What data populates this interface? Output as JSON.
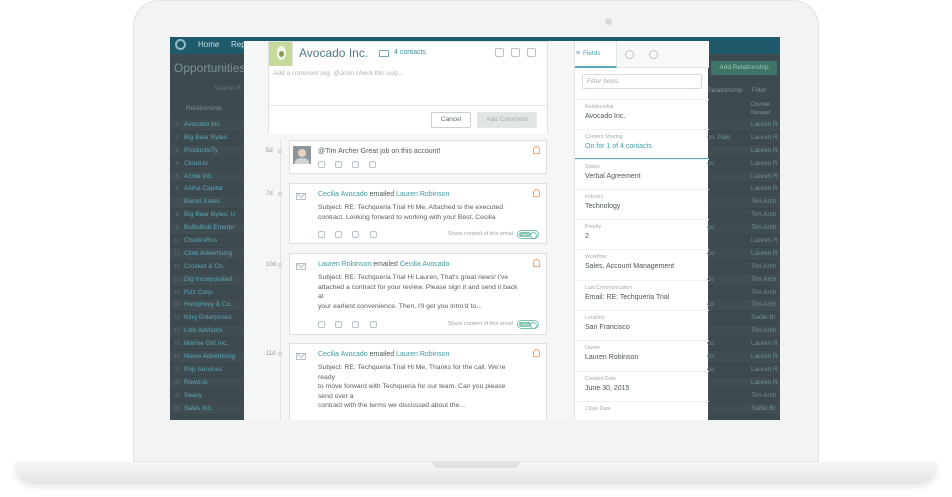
{
  "background_app": {
    "nav": [
      "Home",
      "Rep"
    ],
    "page_title": "Opportunities",
    "search_placeholder": "Search R",
    "add_button": "Add Relationship",
    "filter_label": "Filter",
    "relationship_header": "Relationship",
    "relationship_header_right": "Relationship",
    "owner_header": "Owner",
    "owner_sub": "Manager",
    "rows": [
      {
        "num": "1",
        "name": "Avocado Inc.",
        "mid": "",
        "owner": "Lauren R"
      },
      {
        "num": "2",
        "name": "Big Bear Bytes",
        "mid": "co, Palo",
        "owner": "Lauren R"
      },
      {
        "num": "3",
        "name": "ProductivTy",
        "mid": "",
        "owner": "Lauren R"
      },
      {
        "num": "4",
        "name": "Cloud.io",
        "mid": "co",
        "owner": "Lauren R"
      },
      {
        "num": "5",
        "name": "Acme Inc.",
        "mid": "",
        "owner": "Lauren R"
      },
      {
        "num": "6",
        "name": "Aloha Capital",
        "mid": "",
        "owner": "Lauren R"
      },
      {
        "num": "7",
        "name": "Barrel Sales",
        "mid": "",
        "owner": "Tim Arch"
      },
      {
        "num": "8",
        "name": "Big Bear Bytes: U",
        "mid": "",
        "owner": "Tim Arch"
      },
      {
        "num": "9",
        "name": "BoBoBob Enterpr",
        "mid": "co",
        "owner": "Tim Arch"
      },
      {
        "num": "10",
        "name": "ChecksRus",
        "mid": "",
        "owner": "Lauren R"
      },
      {
        "num": "11",
        "name": "Clink Advertising",
        "mid": "co",
        "owner": "Lauren R"
      },
      {
        "num": "12",
        "name": "Crocket & Co.",
        "mid": "",
        "owner": "Tim Arch"
      },
      {
        "num": "13",
        "name": "Dig Incorporated",
        "mid": "co",
        "owner": "Tim Arch"
      },
      {
        "num": "14",
        "name": "Fizz Corp.",
        "mid": "",
        "owner": "Tim Arch"
      },
      {
        "num": "15",
        "name": "Humphrey & Co.",
        "mid": "co",
        "owner": "Tim Arch"
      },
      {
        "num": "16",
        "name": "King Enterprises",
        "mid": "",
        "owner": "Sadie Br"
      },
      {
        "num": "17",
        "name": "Lolo Advisors",
        "mid": "",
        "owner": "Tim Arch"
      },
      {
        "num": "18",
        "name": "Marine Girl Inc.",
        "mid": "co",
        "owner": "Lauren R"
      },
      {
        "num": "19",
        "name": "Meow Advertising",
        "mid": "co",
        "owner": "Lauren R"
      },
      {
        "num": "20",
        "name": "Pop Services",
        "mid": "co",
        "owner": "Lauren R"
      },
      {
        "num": "21",
        "name": "Rowd.io",
        "mid": "",
        "owner": "Lauren R"
      },
      {
        "num": "22",
        "name": "Seasy",
        "mid": "",
        "owner": "Tim Arch"
      },
      {
        "num": "23",
        "name": "Sales Inc.",
        "mid": "",
        "owner": "Sadie Br"
      }
    ]
  },
  "modal": {
    "company_name": "Avocado Inc.",
    "contacts_label": "4 contacts",
    "comment_placeholder": "Add a comment (eg. @John check this out)...",
    "cancel_label": "Cancel",
    "add_comment_label": "Add Comment",
    "share_label": "Share content of this email",
    "toggle_label": "YES",
    "feed": [
      {
        "age": "5d",
        "text": "@Tim Archer Great job on this account!"
      },
      {
        "age": "7d",
        "from": "Cecilia Avocado",
        "verb": "emailed",
        "to": "Lauren Robinson",
        "body": [
          "Subject: RE: Techqueria Trial Hi Me, Attached is the executed",
          "contract. Looking forward to working with you! Best, Cecilia"
        ]
      },
      {
        "age": "10d",
        "from": "Lauren Robinson",
        "verb": "emailed",
        "to": "Cecilia Avocado",
        "body": [
          "Subject: RE: Techqueria Trial Hi Lauren, That's great news! I've",
          "attached a contract for your review. Please sign it and send it back",
          "at",
          "your earliest convenience. Then, I'll get you intro'd to..."
        ]
      },
      {
        "age": "11d",
        "from": "Cecilia Avocado",
        "verb": "emailed",
        "to": "Lauren Robinson",
        "body": [
          "Subject: RE: Techqueria Trial Hi Me, Thanks for the call. We're",
          "ready",
          "to move forward with Techqueria for our team. Can you please",
          "send over a",
          "contract with the terms we discussed about the..."
        ]
      }
    ]
  },
  "fields_panel": {
    "tab_label": "Fields",
    "filter_placeholder": "Filter fields",
    "fields": [
      {
        "label": "Relationship",
        "value": "Avocado Inc."
      },
      {
        "label": "Content Sharing",
        "value": "On for 1 of 4 contacts"
      },
      {
        "label": "Status",
        "value": "Verbal Agreement"
      },
      {
        "label": "Industry",
        "value": "Technology"
      },
      {
        "label": "Priority",
        "value": "2"
      },
      {
        "label": "Workflow",
        "value": "Sales, Account Management"
      },
      {
        "label": "Last Communication",
        "value": "Email: RE: Techqueria Trial"
      },
      {
        "label": "Location",
        "value": "San Francisco"
      },
      {
        "label": "Owner",
        "value": "Lauren Robinson"
      },
      {
        "label": "Created Date",
        "value": "June 30, 2015"
      },
      {
        "label": "Close Date",
        "value": ""
      }
    ]
  },
  "colors": {
    "accent": "#3f9fb2",
    "nav": "#1f5a6a",
    "notification": "#f0a56a"
  }
}
